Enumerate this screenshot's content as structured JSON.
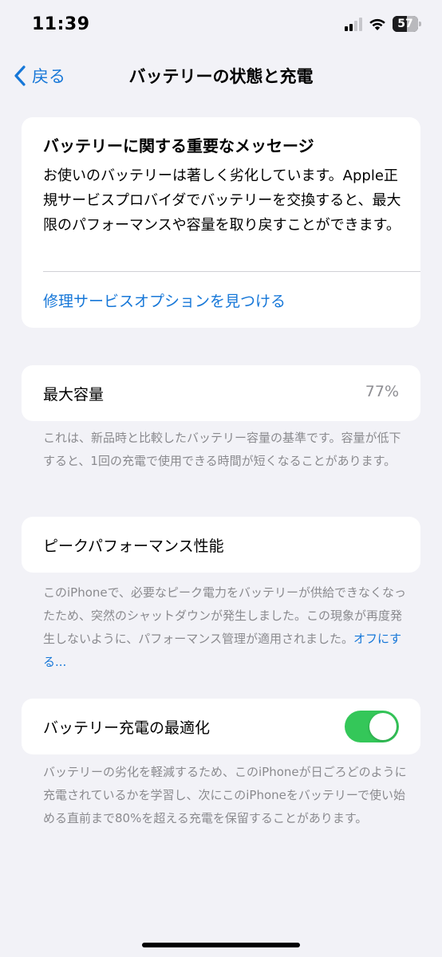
{
  "status_bar": {
    "time": "11:39",
    "battery_level": "57",
    "battery_fill_fraction": 0.57
  },
  "nav": {
    "back_label": "戻る",
    "title": "バッテリーの状態と充電"
  },
  "important_message": {
    "title": "バッテリーに関する重要なメッセージ",
    "body": "お使いのバッテリーは著しく劣化しています。Apple正規サービスプロバイダでバッテリーを交換すると、最大限のパフォーマンスや容量を取り戻すことができます。",
    "link": "修理サービスオプションを見つける"
  },
  "maximum_capacity": {
    "label": "最大容量",
    "value": "77%",
    "footnote": "これは、新品時と比較したバッテリー容量の基準です。容量が低下すると、1回の充電で使用できる時間が短くなることがあります。"
  },
  "peak_performance": {
    "label": "ピークパフォーマンス性能",
    "footnote": "このiPhoneで、必要なピーク電力をバッテリーが供給できなくなったため、突然のシャットダウンが発生しました。この現象が再度発生しないように、パフォーマンス管理が適用されました。",
    "footnote_link": "オフにする..."
  },
  "optimized_charging": {
    "label": "バッテリー充電の最適化",
    "toggle_on": true,
    "footnote": "バッテリーの劣化を軽減するため、このiPhoneが日ごろどのように充電されているかを学習し、次にこのiPhoneをバッテリーで使い始める直前まで80%を超える充電を保留することがあります。"
  },
  "colors": {
    "accent": "#1677d8",
    "toggle_on": "#34c759",
    "background": "#f2f2f7",
    "secondary_text": "#8a8a8e"
  }
}
